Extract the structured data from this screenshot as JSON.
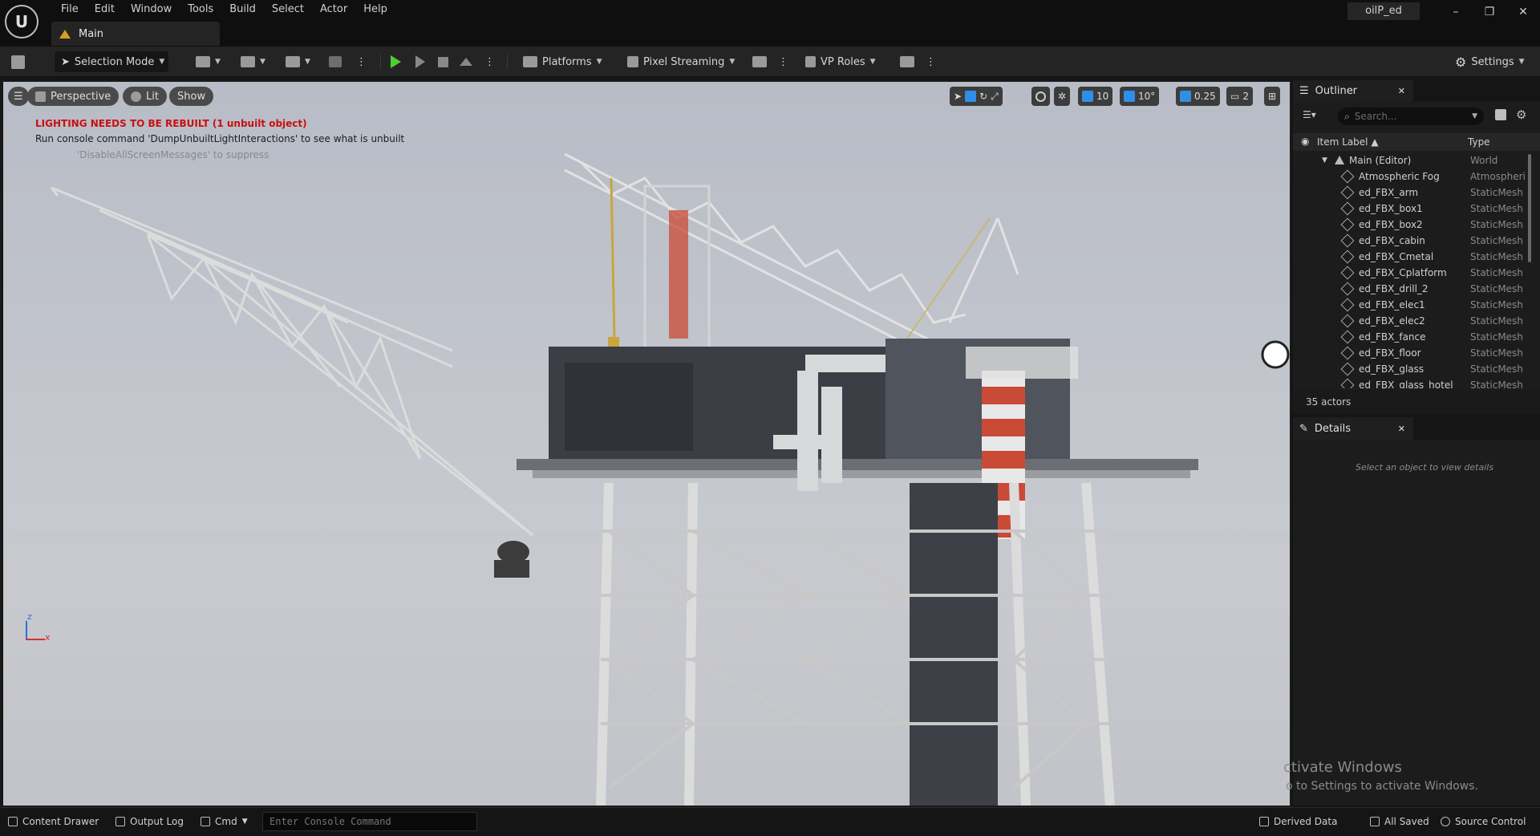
{
  "menubar": {
    "logo": "U",
    "items": [
      "File",
      "Edit",
      "Window",
      "Tools",
      "Build",
      "Select",
      "Actor",
      "Help"
    ],
    "tab_label": "Main",
    "app_name": "oilP_ed",
    "win_minimize": "–",
    "win_restore": "❐",
    "win_close": "✕"
  },
  "toolbar": {
    "selection_mode": "Selection Mode",
    "platforms": "Platforms",
    "pixel_streaming": "Pixel Streaming",
    "vp_roles": "VP Roles",
    "settings": "Settings"
  },
  "viewport": {
    "perspective": "Perspective",
    "lit": "Lit",
    "show": "Show",
    "msg_lighting": "LIGHTING NEEDS TO BE REBUILT (1 unbuilt object)",
    "msg_console": "Run console command 'DumpUnbuiltLightInteractions' to see what is unbuilt",
    "msg_suppress": "'DisableAllScreenMessages' to suppress",
    "grid_snap": "10",
    "rot_snap": "10°",
    "scale_snap": "0.25",
    "cam_speed": "2",
    "axis_z": "z",
    "axis_x": "x"
  },
  "outliner": {
    "tab_label": "Outliner",
    "close": "✕",
    "search_placeholder": "Search...",
    "col_label": "Item Label ▲",
    "col_type": "Type",
    "rows": [
      {
        "label": "Main (Editor)",
        "type": "World"
      },
      {
        "label": "Atmospheric Fog",
        "type": "Atmospheri"
      },
      {
        "label": "ed_FBX_arm",
        "type": "StaticMesh"
      },
      {
        "label": "ed_FBX_box1",
        "type": "StaticMesh"
      },
      {
        "label": "ed_FBX_box2",
        "type": "StaticMesh"
      },
      {
        "label": "ed_FBX_cabin",
        "type": "StaticMesh"
      },
      {
        "label": "ed_FBX_Cmetal",
        "type": "StaticMesh"
      },
      {
        "label": "ed_FBX_Cplatform",
        "type": "StaticMesh"
      },
      {
        "label": "ed_FBX_drill_2",
        "type": "StaticMesh"
      },
      {
        "label": "ed_FBX_elec1",
        "type": "StaticMesh"
      },
      {
        "label": "ed_FBX_elec2",
        "type": "StaticMesh"
      },
      {
        "label": "ed_FBX_fance",
        "type": "StaticMesh"
      },
      {
        "label": "ed_FBX_floor",
        "type": "StaticMesh"
      },
      {
        "label": "ed_FBX_glass",
        "type": "StaticMesh"
      },
      {
        "label": "ed_FBX_glass_hotel",
        "type": "StaticMesh"
      }
    ],
    "actor_count": "35 actors"
  },
  "details": {
    "tab_label": "Details",
    "close": "✕",
    "empty_text": "Select an object to view details"
  },
  "watermark": {
    "line1": "ctivate Windows",
    "line2": "o to Settings to activate Windows."
  },
  "statusbar": {
    "content_drawer": "Content Drawer",
    "output_log": "Output Log",
    "cmd": "Cmd",
    "console_placeholder": "Enter Console Command",
    "derived_data": "Derived Data",
    "all_saved": "All Saved",
    "source_control": "Source Control"
  },
  "colors": {
    "play_green": "#4fcf34",
    "accent_blue": "#2f8fe6",
    "error_red": "#c81010",
    "tab_orange": "#d89a28",
    "rig_red": "#c94a35"
  }
}
